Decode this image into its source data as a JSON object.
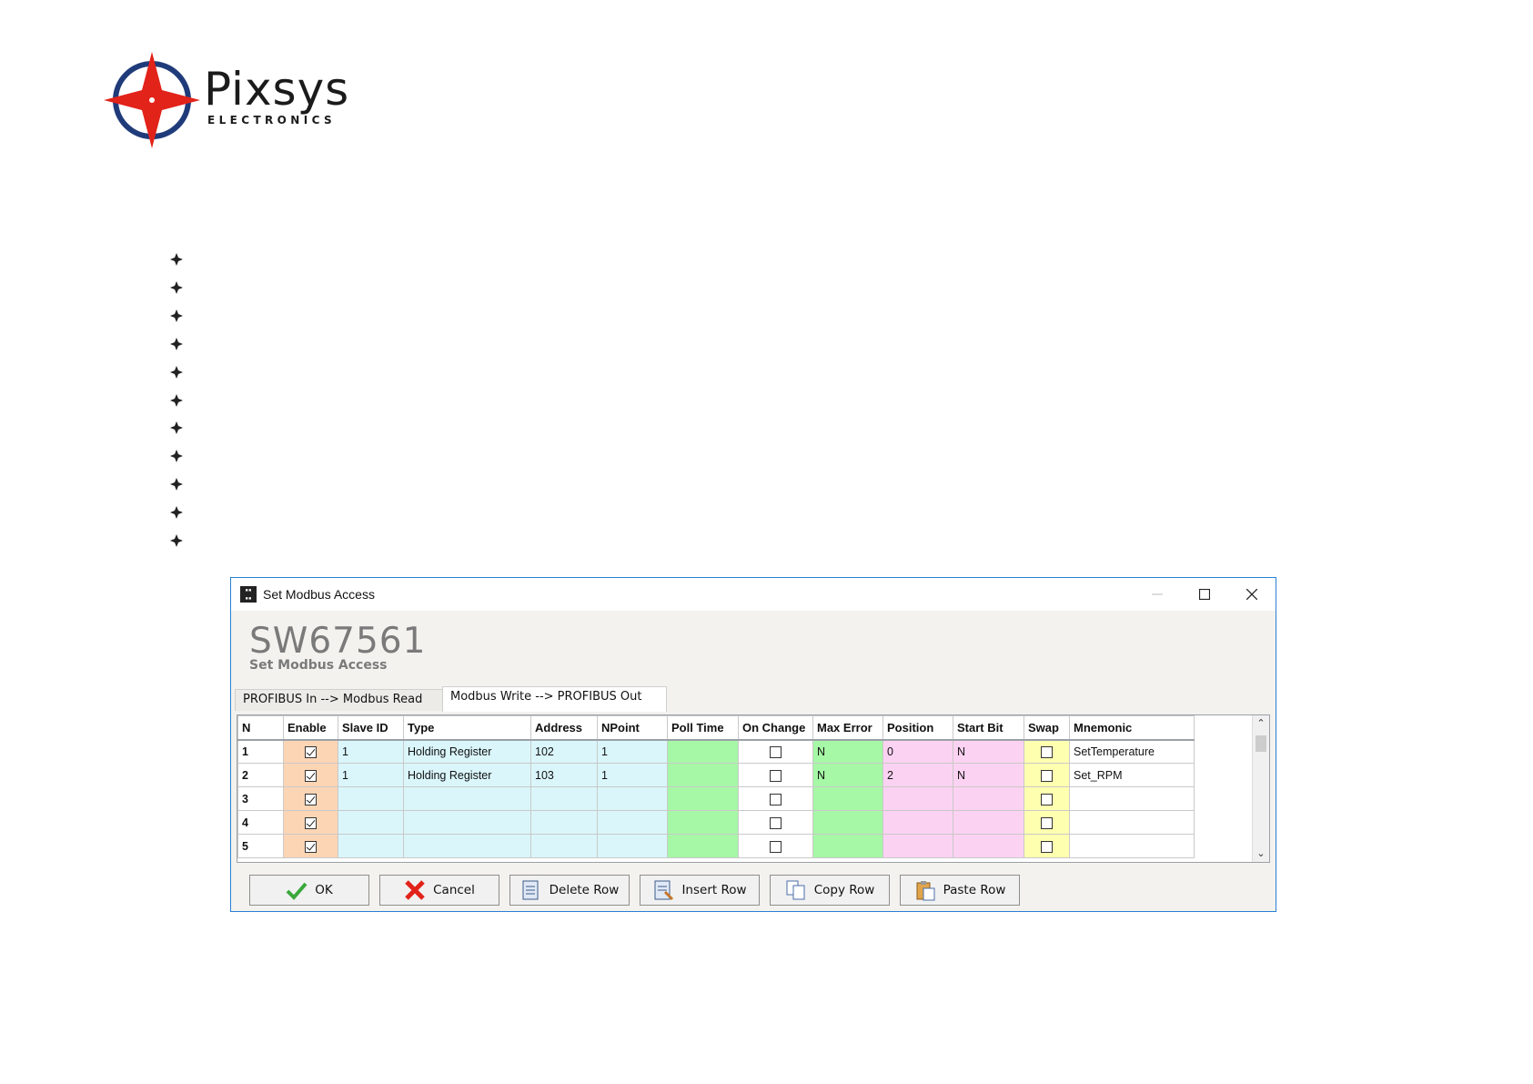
{
  "logo": {
    "name": "Pixsys",
    "tagline": "ELECTRONICS"
  },
  "dialog": {
    "window_title": "Set Modbus Access",
    "big_title": "SW67561",
    "subtitle": "Set Modbus Access",
    "tabs": [
      "PROFIBUS In --> Modbus Read",
      "Modbus Write --> PROFIBUS Out"
    ],
    "columns": [
      "N",
      "Enable",
      "Slave ID",
      "Type",
      "Address",
      "NPoint",
      "Poll Time",
      "On Change",
      "Max Error",
      "Position",
      "Start Bit",
      "Swap",
      "Mnemonic"
    ],
    "rows": [
      {
        "n": "1",
        "enable": true,
        "slave_id": "1",
        "type": "Holding Register",
        "address": "102",
        "npoint": "1",
        "poll_time": "",
        "on_change": false,
        "max_error": "N",
        "position": "0",
        "start_bit": "N",
        "swap": false,
        "mnemonic": "SetTemperature"
      },
      {
        "n": "2",
        "enable": true,
        "slave_id": "1",
        "type": "Holding Register",
        "address": "103",
        "npoint": "1",
        "poll_time": "",
        "on_change": false,
        "max_error": "N",
        "position": "2",
        "start_bit": "N",
        "swap": false,
        "mnemonic": "Set_RPM"
      },
      {
        "n": "3",
        "enable": true,
        "slave_id": "",
        "type": "",
        "address": "",
        "npoint": "",
        "poll_time": "",
        "on_change": false,
        "max_error": "",
        "position": "",
        "start_bit": "",
        "swap": false,
        "mnemonic": ""
      },
      {
        "n": "4",
        "enable": true,
        "slave_id": "",
        "type": "",
        "address": "",
        "npoint": "",
        "poll_time": "",
        "on_change": false,
        "max_error": "",
        "position": "",
        "start_bit": "",
        "swap": false,
        "mnemonic": ""
      },
      {
        "n": "5",
        "enable": true,
        "slave_id": "",
        "type": "",
        "address": "",
        "npoint": "",
        "poll_time": "",
        "on_change": false,
        "max_error": "",
        "position": "",
        "start_bit": "",
        "swap": false,
        "mnemonic": ""
      }
    ],
    "buttons": {
      "ok": "OK",
      "cancel": "Cancel",
      "delete_row": "Delete Row",
      "insert_row": "Insert Row",
      "copy_row": "Copy Row",
      "paste_row": "Paste Row"
    }
  },
  "colors": {
    "enable": "#fcd5b4",
    "cyan": "#daf6fb",
    "green": "#a6f7a6",
    "pink": "#fcd2f2",
    "yellow": "#ffffb0",
    "window_border": "#2a7fd4",
    "logo_red": "#e2231a",
    "logo_blue": "#1f3b7a"
  }
}
